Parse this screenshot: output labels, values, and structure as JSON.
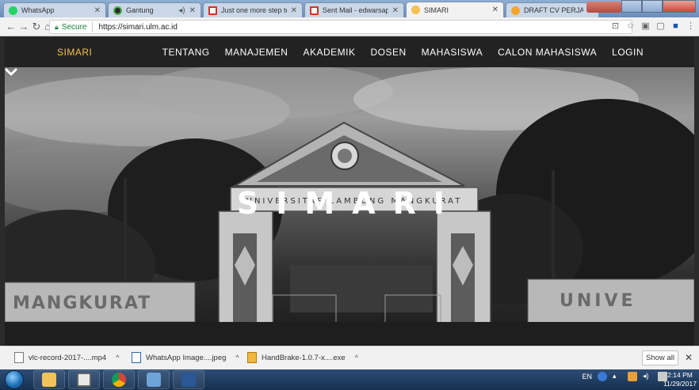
{
  "tabs": [
    {
      "title": "WhatsApp",
      "color": "#25d366"
    },
    {
      "title": "Gantung",
      "color": "#2b2b2b"
    },
    {
      "title": "Just one more step to co",
      "color": "#d93025"
    },
    {
      "title": "Sent Mail - edwarsaputr",
      "color": "#d93025"
    },
    {
      "title": "SIMARI",
      "color": "#f4c150"
    },
    {
      "title": "DRAFT CV PERJADIN UN",
      "color": "#f4a52c"
    }
  ],
  "address": {
    "secure_label": "Secure",
    "url": "https://simari.ulm.ac.id"
  },
  "site": {
    "brand": "SIMARI",
    "nav": [
      "TENTANG",
      "MANAJEMEN",
      "AKADEMIK",
      "DOSEN",
      "MAHASISWA",
      "CALON MAHASISWA",
      "LOGIN"
    ],
    "hero_title": "SIMARI",
    "gate_inscription": "UNIVERSITAS LAMBUNG MANGKURAT",
    "base_text_left": "MANGKURAT",
    "base_text_right": "UNIVE"
  },
  "downloads": [
    {
      "name": "vlc-record-2017-....mp4"
    },
    {
      "name": "WhatsApp Image....jpeg"
    },
    {
      "name": "HandBrake-1.0.7-x....exe"
    }
  ],
  "downloads_show_all": "Show all",
  "taskbar": {
    "language": "EN",
    "time": "2:14 PM",
    "date": "11/29/2017"
  }
}
